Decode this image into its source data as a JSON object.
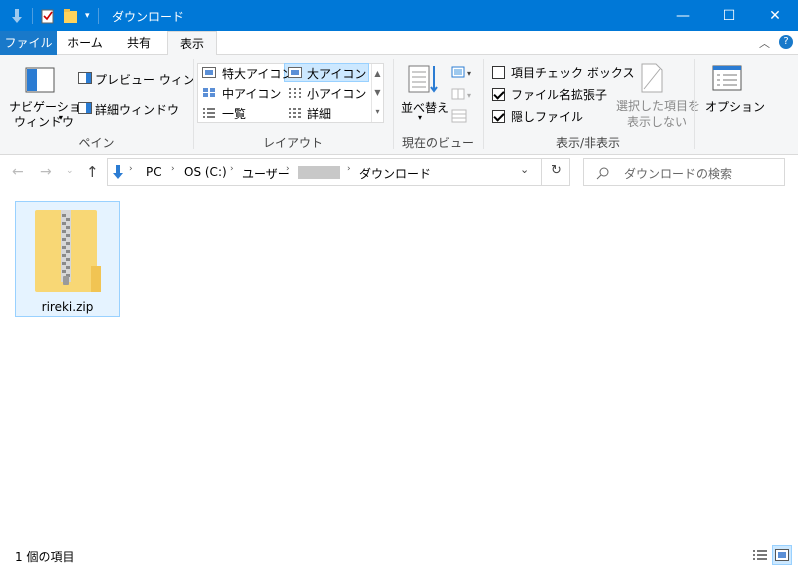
{
  "window": {
    "title": "ダウンロード",
    "controls": {
      "minimize": "—",
      "maximize": "☐",
      "close": "✕"
    }
  },
  "ribbon_tabs": [
    "ファイル",
    "ホーム",
    "共有",
    "表示"
  ],
  "ribbon": {
    "pane_group": {
      "nav_pane": "ナビゲーション",
      "nav_pane2": "ウィンドウ",
      "preview": "プレビュー ウィンドウ",
      "details_pane": "詳細ウィンドウ",
      "label": "ペイン"
    },
    "layout_group": {
      "items": [
        "特大アイコン",
        "大アイコン",
        "中アイコン",
        "小アイコン",
        "一覧",
        "詳細"
      ],
      "label": "レイアウト"
    },
    "current_view_group": {
      "sort": "並べ替え",
      "label": "現在のビュー"
    },
    "show_hide_group": {
      "item_checkbox": "項目チェック ボックス",
      "file_ext": "ファイル名拡張子",
      "hidden_files": "隠しファイル",
      "hide_selected_1": "選択した項目を",
      "hide_selected_2": "表示しない",
      "label": "表示/非表示"
    },
    "options": "オプション"
  },
  "checkbox_state": {
    "item_checkbox": false,
    "file_ext": true,
    "hidden_files": true
  },
  "address": {
    "crumbs": [
      "PC",
      "OS (C:)",
      "ユーザー",
      "",
      "ダウンロード"
    ],
    "search_placeholder": "ダウンロードの検索"
  },
  "files": [
    {
      "name": "rireki.zip",
      "icon": "zip-folder-icon"
    }
  ],
  "status": {
    "count": "1 個の項目"
  },
  "colors": {
    "accent": "#0078d7",
    "selection": "#e5f3ff",
    "selection_border": "#99d1ff"
  }
}
